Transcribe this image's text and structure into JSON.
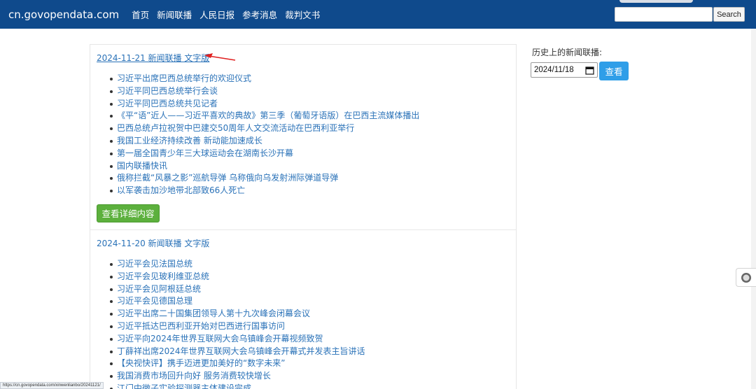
{
  "header": {
    "brand": "cn.govopendata.com",
    "nav": [
      "首页",
      "新闻联播",
      "人民日报",
      "参考消息",
      "裁判文书"
    ],
    "search_button": "Search",
    "search_value": ""
  },
  "days": [
    {
      "title": "2024-11-21 新闻联播 文字版",
      "items": [
        "习近平出席巴西总统举行的欢迎仪式",
        "习近平同巴西总统举行会谈",
        "习近平同巴西总统共见记者",
        "《平“语”近人——习近平喜欢的典故》第三季（葡萄牙语版）在巴西主流媒体播出",
        "巴西总统卢拉祝贺中巴建交50周年人文交流活动在巴西利亚举行",
        "我国工业经济持续改善 新动能加速成长",
        "第一届全国青少年三大球运动会在湖南长沙开幕",
        "国内联播快讯",
        "俄称拦截“风暴之影”巡航导弹 乌称俄向乌发射洲际弹道导弹",
        "以军袭击加沙地带北部致66人死亡"
      ],
      "detail_button": "查看详细内容"
    },
    {
      "title": "2024-11-20 新闻联播 文字版",
      "items": [
        "习近平会见法国总统",
        "习近平会见玻利维亚总统",
        "习近平会见阿根廷总统",
        "习近平会见德国总理",
        "习近平出席二十国集团领导人第十九次峰会闭幕会议",
        "习近平抵达巴西利亚开始对巴西进行国事访问",
        "习近平向2024年世界互联网大会乌镇峰会开幕视频致贺",
        "丁薛祥出席2024年世界互联网大会乌镇峰会开幕式并发表主旨讲话",
        "【央视快评】携手迈进更加美好的“数字未来”",
        "我国消费市场回升向好 服务消费较快增长",
        "江门中微子实验探测器主体建设完成"
      ]
    }
  ],
  "sidebar": {
    "label": "历史上的新闻联播:",
    "date_value": "2024/11/18",
    "view_button": "查看"
  },
  "status_bar": {
    "url": "https://cn.govopendata.com/xinwenlianbo/20241121/"
  },
  "colors": {
    "navbar": "#0f4a8c",
    "link": "#2a72b8",
    "detail_button": "#5cb03d",
    "view_button": "#2f9ee8",
    "annotation_arrow": "#e02020"
  }
}
